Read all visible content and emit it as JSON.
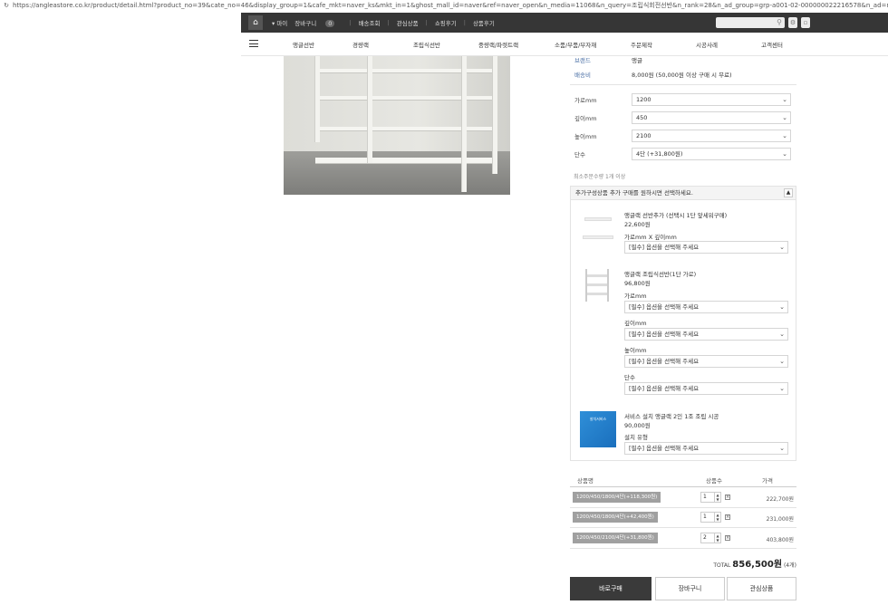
{
  "browser": {
    "url": "https://angleastore.co.kr/product/detail.html?product_no=39&cate_no=46&display_group=1&cafe_mkt=naver_ks&mkt_in=1&ghost_mall_id=naver&ref=naver_open&n_media=11068&n_query=조립식회전선반&n_rank=28&n_ad_group=grp-a001-02-000000022216578&n_ad=nad-a001-02-000000265381006"
  },
  "topbar": {
    "home_label": "⌂",
    "links": [
      "▾ 마이",
      "장바구니",
      "알림",
      "배송조회",
      "관심상품",
      "쇼핑후기",
      "상품후기"
    ],
    "cart_count": "0",
    "search_icon": "search-icon",
    "icons": [
      "settings-icon",
      "cart-icon"
    ]
  },
  "mainnav": {
    "items": [
      "앵글선반",
      "경량랙",
      "조립식선반",
      "중량랙/파렛트랙",
      "소품/부품/부자재",
      "주문제작",
      "시공사례",
      "고객센터"
    ]
  },
  "info": {
    "brand_label": "브랜드",
    "brand_value": "앵글",
    "shipping_label": "배송비",
    "shipping_value": "8,000원 (50,000원 이상 구매 시 무료)"
  },
  "options": [
    {
      "label": "가로mm",
      "value": "1200"
    },
    {
      "label": "깊이mm",
      "value": "450"
    },
    {
      "label": "높이mm",
      "value": "2100"
    },
    {
      "label": "단수",
      "value": "4단 (+31,800원)"
    }
  ],
  "option_note": "최소주문수량 1개 이상",
  "additional": {
    "header": "추가구성상품 추가 구매를 원하시면 선택하세요.",
    "toggle": "▲",
    "products": [
      {
        "name": "앵글랙 선반추가 (선택시 1단 앞세워구매)",
        "price": "22,600원",
        "field_label": "가로mm X 깊이mm",
        "select": "[필수] 옵션을 선택해 주세요"
      },
      {
        "name": "앵글랙 조립식선반(1단 가로)",
        "price": "96,800원",
        "fields": [
          {
            "label": "가로mm",
            "select": "[필수] 옵션을 선택해 주세요"
          },
          {
            "label": "깊이mm",
            "select": "[필수] 옵션을 선택해 주세요"
          },
          {
            "label": "높이mm",
            "select": "[필수] 옵션을 선택해 주세요"
          },
          {
            "label": "단수",
            "select": "[필수] 옵션을 선택해 주세요"
          }
        ]
      },
      {
        "name": "서비스 설치 앵글랙 2인 1조 조립 시공",
        "price": "90,000원",
        "field_label": "설치 유형",
        "select": "[필수] 옵션을 선택해 주세요",
        "thumb_text": "설치서비스"
      }
    ]
  },
  "table": {
    "headers": [
      "상품명",
      "상품수",
      "가격"
    ],
    "rows": [
      {
        "name": "1200/450/1800/4단(+118,300원)",
        "qty": "1",
        "amount": "222,700원"
      },
      {
        "name": "1200/450/1800/4단(+42,400원)",
        "qty": "1",
        "amount": "231,000원"
      },
      {
        "name": "1200/450/2100/4단(+31,800원)",
        "qty": "2",
        "amount": "403,800원"
      }
    ]
  },
  "total": {
    "label": "TOTAL",
    "amount": "856,500원",
    "count": "(4개)"
  },
  "buttons": {
    "buy": "바로구매",
    "cart": "장바구니",
    "wish": "관심상품"
  }
}
